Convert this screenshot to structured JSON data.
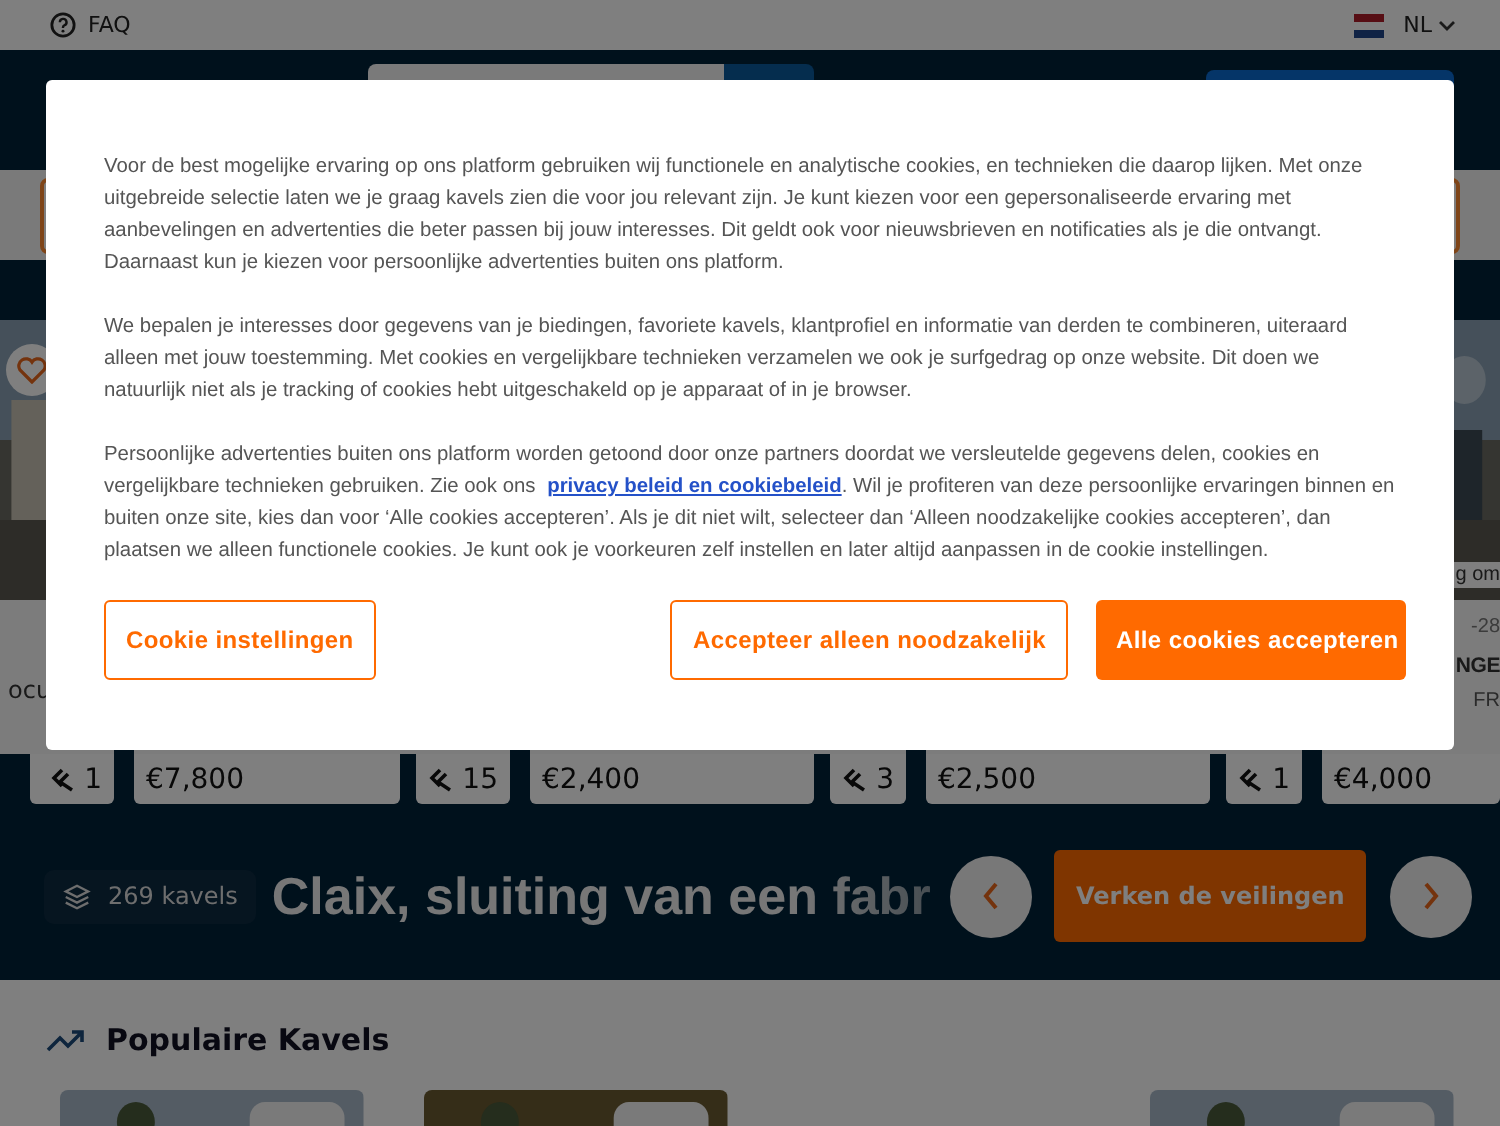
{
  "top_bar": {
    "faq": "FAQ",
    "language": "NL"
  },
  "lot_cards": [
    {
      "kind": "partial",
      "title": "ocu",
      "bids": "1"
    },
    {
      "kind": "full",
      "price": "€7,800",
      "bids": "15"
    },
    {
      "kind": "full",
      "price": "€2,400",
      "bids": "3"
    },
    {
      "kind": "full",
      "price": "€2,500",
      "bids": "1"
    },
    {
      "kind": "partial",
      "caption": "g om",
      "date": "-28",
      "title": "NGE",
      "location": "FR",
      "price": "€4,000"
    }
  ],
  "auction": {
    "lot_count": "269 kavels",
    "title": "Claix, sluiting van een fabr",
    "cta": "Verken de veilingen"
  },
  "popular": {
    "title": "Populaire Kavels",
    "cards": [
      {
        "kind": "picture"
      },
      {
        "kind": "picture"
      },
      {
        "kind": "empty"
      },
      {
        "kind": "picture"
      }
    ]
  },
  "cookie_dialog": {
    "paragraphs": [
      "Voor de best mogelijke ervaring op ons platform gebruiken wij functionele en analytische cookies, en technieken die daarop lijken. Met onze uitgebreide selectie laten we je graag kavels zien die voor jou relevant zijn. Je kunt kiezen voor een gepersonaliseerde ervaring met aanbevelingen en advertenties die beter passen bij jouw interesses. Dit geldt ook voor nieuwsbrieven en notificaties als je die ontvangt. Daarnaast kun je kiezen voor persoonlijke advertenties buiten ons platform.",
      "We bepalen je interesses door gegevens van je biedingen, favoriete kavels, klantprofiel en informatie van derden te combineren, uiteraard alleen met jouw toestemming. Met cookies en vergelijkbare technieken verzamelen we ook je surfgedrag op onze website. Dit doen we natuurlijk niet als je tracking of cookies hebt uitgeschakeld op je apparaat of in je browser."
    ],
    "last_paragraph": {
      "before": "Persoonlijke advertenties buiten ons platform worden getoond door onze partners doordat we versleutelde gegevens delen, cookies en vergelijkbare technieken gebruiken. Zie ook ons",
      "link": "privacy beleid en cookiebeleid",
      "after": ". Wil je profiteren van deze persoonlijke ervaringen binnen en buiten onze site, kies dan voor ‘Alle cookies accepteren’. Als je dit niet wilt, selecteer dan ‘Alleen noodzakelijke cookies accepteren’, dan plaatsen we alleen functionele cookies. Je kunt ook je voorkeuren zelf instellen en later altijd aanpassen in de cookie instellingen."
    },
    "buttons": [
      {
        "label": "Cookie instellingen",
        "kind": "outline"
      },
      {
        "label": "Accepteer alleen noodzakelijk",
        "kind": "outline"
      },
      {
        "label": "Alle cookies accepteren",
        "kind": "primary"
      }
    ]
  }
}
